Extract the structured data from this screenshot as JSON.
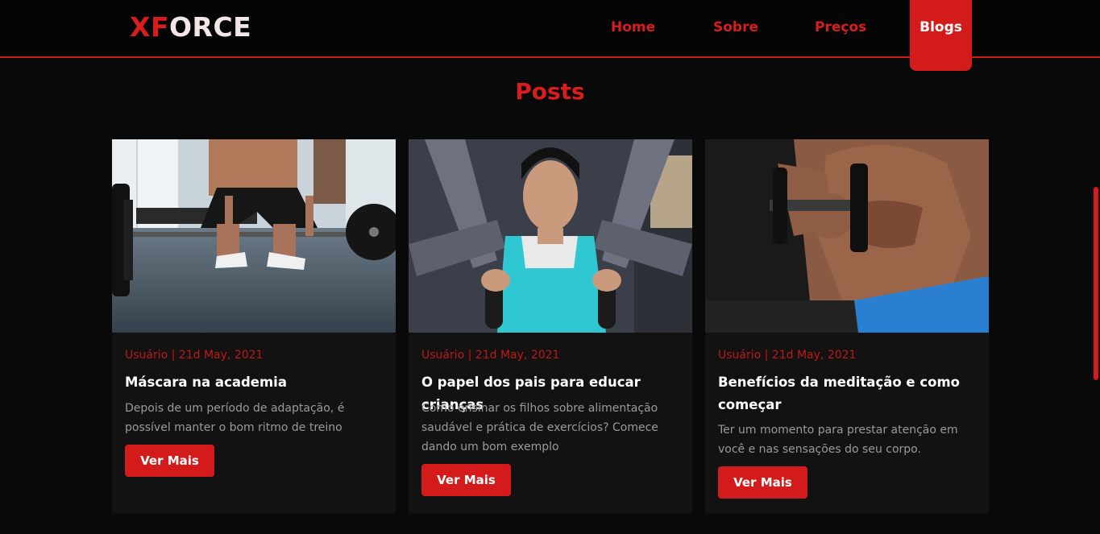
{
  "header": {
    "logo_part1": "XF",
    "logo_part2": "ORCE",
    "nav": {
      "home": "Home",
      "sobre": "Sobre",
      "precos": "Preços",
      "blogs": "Blogs"
    },
    "active_nav": "Blogs"
  },
  "colors": {
    "accent": "#d41b1b",
    "background": "#090909",
    "card": "#121212"
  },
  "section": {
    "title": "Posts"
  },
  "posts": [
    {
      "meta": "Usuário | 21d May, 2021",
      "title": "Máscara na academia",
      "description": "Depois de um período de adaptação, é possível manter o bom ritmo de treino",
      "button": "Ver Mais",
      "image": "deadlift-gym-photo"
    },
    {
      "meta": "Usuário | 21d May, 2021",
      "title": "O papel dos pais para educar crianças",
      "description": "Como ensinar os filhos sobre alimentação saudável e prática de exercícios? Comece dando um bom exemplo",
      "button": "Ver Mais",
      "image": "woman-chest-press-machine-photo"
    },
    {
      "meta": "Usuário | 21d May, 2021",
      "title": "Benefícios da meditação e como começar",
      "description": "Ter um momento para prestar atenção em você e nas sensações do seu corpo.",
      "button": "Ver Mais",
      "image": "man-dumbbell-curl-photo"
    }
  ]
}
